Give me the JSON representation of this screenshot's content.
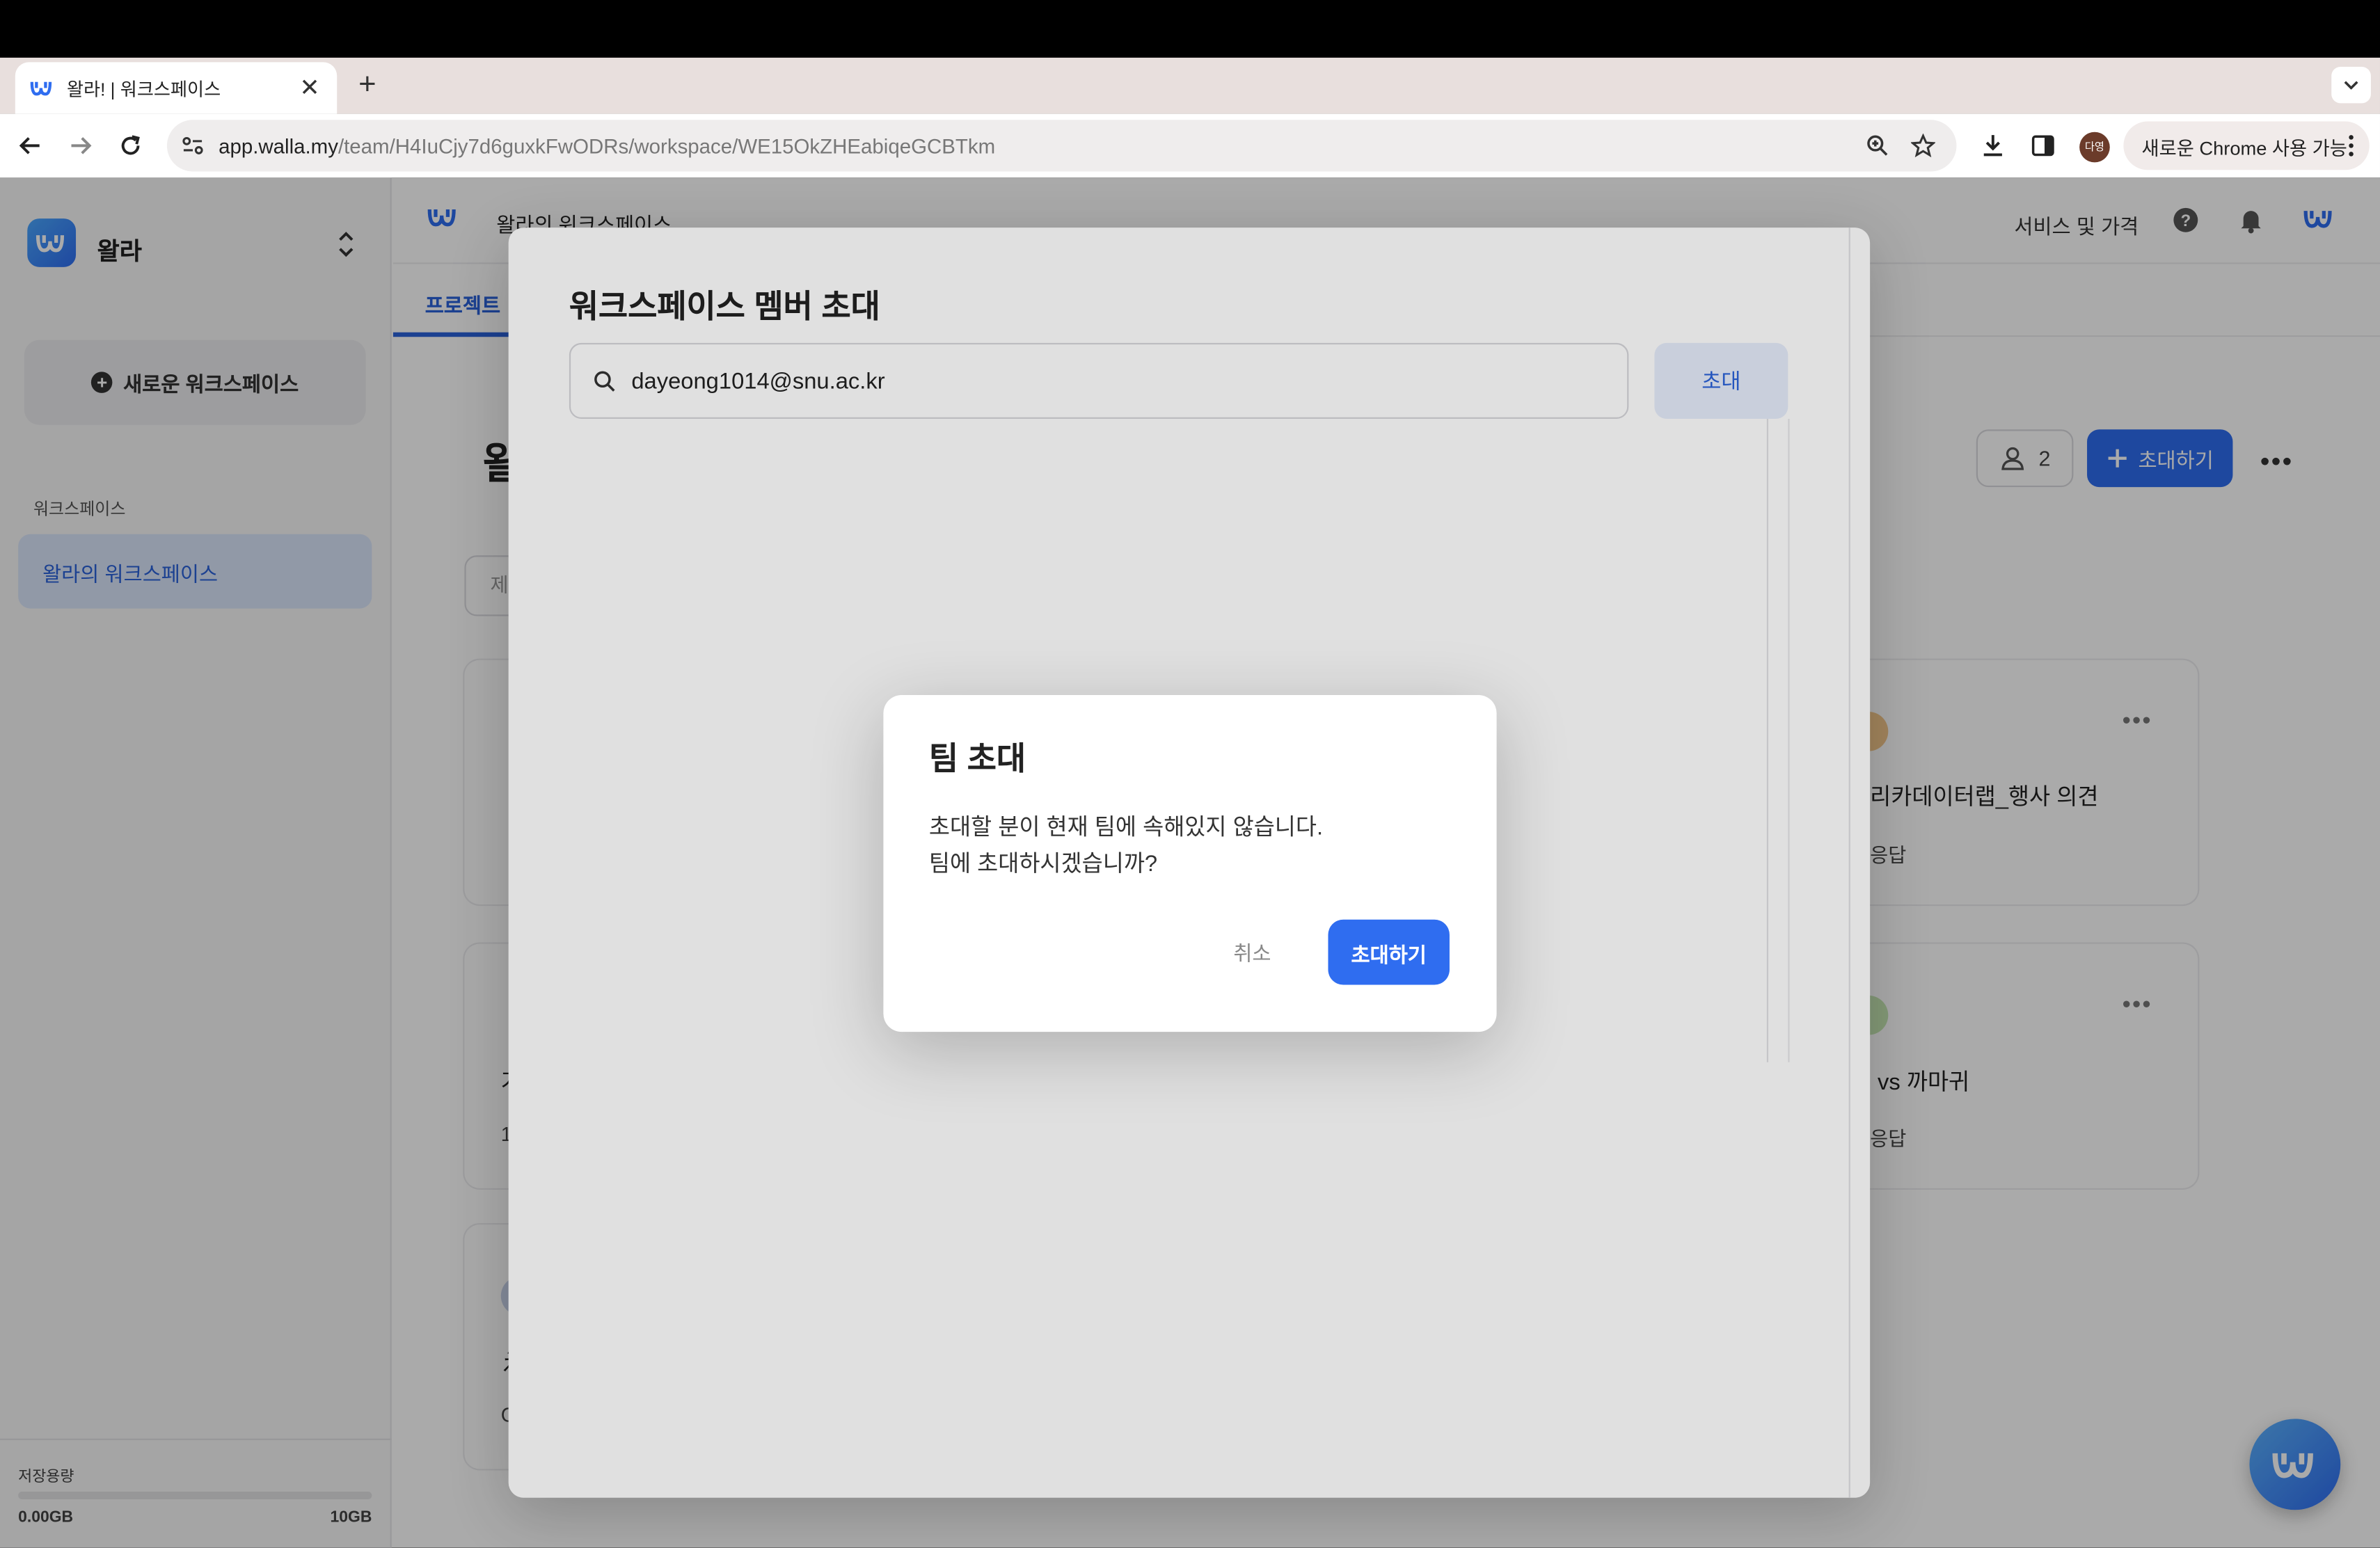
{
  "browser": {
    "tab_title": "왈라! | 워크스페이스",
    "url_host": "app.walla.my",
    "url_path": "/team/H4IuCjy7d6guxkFwODRs/workspace/WE15OkZHEabiqeGCBTkm",
    "profile_label": "다영",
    "chrome_button_label": "새로운 Chrome 사용 가능"
  },
  "sidebar": {
    "team_name": "왈라",
    "new_workspace_label": "새로운 워크스페이스",
    "section_label": "워크스페이스",
    "active_workspace": "왈라의 워크스페이스",
    "storage_label": "저장용량",
    "storage_used": "0.00GB",
    "storage_total": "10GB",
    "storage_fraction": 0.0
  },
  "topbar": {
    "workspace_name": "왈라의 워크스페이스",
    "services_label": "서비스 및 가격"
  },
  "tabs": {
    "projects": "프로젝트"
  },
  "page": {
    "title_partial": "왈",
    "members_count": "2",
    "invite_label": "초대하기",
    "search_placeholder_partial": "제"
  },
  "cards": [
    {
      "title_partial": "리카데이터랩_행사 의견",
      "sub_partial": "응답"
    },
    {
      "title_partial": "vs 까마귀",
      "sub_partial": "응답"
    },
    {
      "title_partial": "가",
      "sub_partial": "1"
    },
    {
      "title_partial": "え",
      "sub_partial": "C"
    }
  ],
  "invite_modal": {
    "title": "워크스페이스 멤버 초대",
    "email_value": "dayeong1014@snu.ac.kr",
    "invite_button": "초대"
  },
  "confirm_dialog": {
    "title": "팀 초대",
    "message": "초대할 분이 현재 팀에 속해있지 않습니다.\n팀에 초대하시겠습니까?",
    "cancel_label": "취소",
    "confirm_label": "초대하기"
  },
  "colors": {
    "accent": "#2f6df0",
    "accent_light": "#e5ecfb",
    "sidebar_active": "#dbe6fb"
  }
}
